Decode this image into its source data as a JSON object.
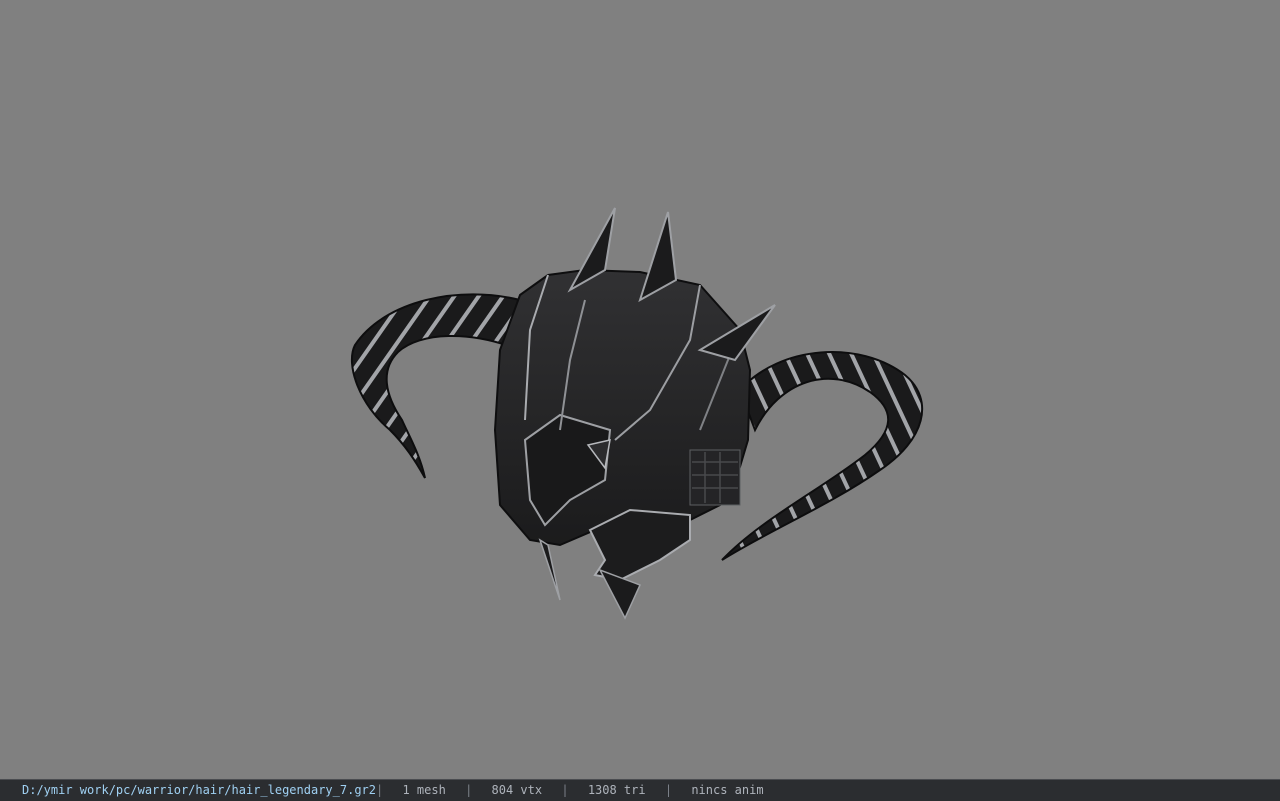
{
  "viewport": {
    "background_color": "#808080",
    "model": {
      "name": "horned-helmet",
      "primary_color": "#1d1d1f",
      "edge_color": "#b9bbbf",
      "stripe_color": "#9fa1a4"
    }
  },
  "status_bar": {
    "file_path": "D:/ymir work/pc/warrior/hair/hair_legendary_7.gr2",
    "separator": "|",
    "mesh_count": "1 mesh",
    "vertex_count": "804 vtx",
    "triangle_count": "1308 tri",
    "animation": "nincs anim"
  }
}
